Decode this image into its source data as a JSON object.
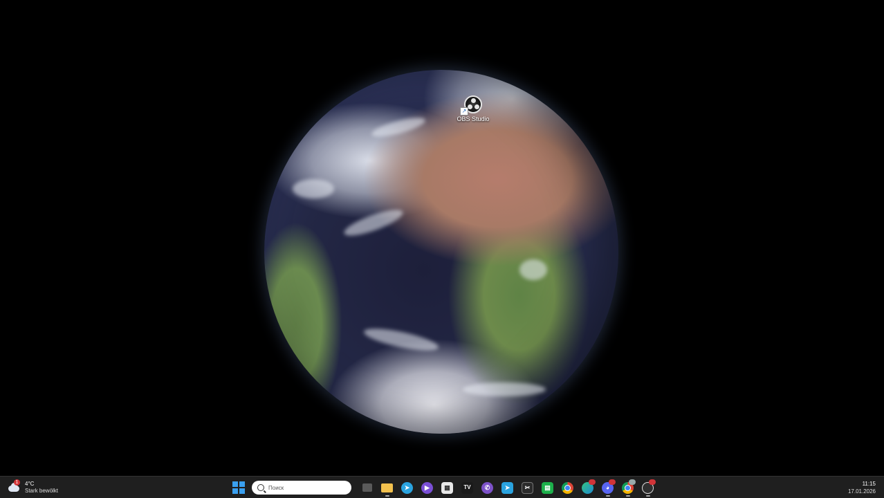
{
  "desktop": {
    "wallpaper": "earth-full-disk",
    "shortcuts": [
      {
        "label": "OBS Studio",
        "icon": "obs-studio-icon"
      }
    ]
  },
  "taskbar": {
    "weather": {
      "temperature": "4°C",
      "description": "Stark bewölkt",
      "badge": "1",
      "icon": "cloud-icon"
    },
    "search": {
      "placeholder": "Поиск"
    },
    "apps": [
      {
        "name": "task-view-icon",
        "color": "#5a5a5a"
      },
      {
        "name": "file-explorer-icon",
        "color": "#f2c14e"
      },
      {
        "name": "telegram-icon",
        "color": "#2aa3df"
      },
      {
        "name": "media-player-icon",
        "color": "#7a4fd6"
      },
      {
        "name": "calendar-app-icon",
        "color": "#e8e8e8"
      },
      {
        "name": "tradingview-icon",
        "color": "#1a1a1a"
      },
      {
        "name": "viber-icon",
        "color": "#7d52c9"
      },
      {
        "name": "telegram-desktop-icon",
        "color": "#2aa3df"
      },
      {
        "name": "capcut-icon",
        "color": "#2b2b2b"
      },
      {
        "name": "sheets-app-icon",
        "color": "#1db04b"
      },
      {
        "name": "chrome-icon",
        "color": "#e8e8e8"
      },
      {
        "name": "edge-icon",
        "color": "#1f8ad2"
      },
      {
        "name": "discord-icon",
        "color": "#5865f2"
      },
      {
        "name": "chrome-profile-icon",
        "color": "#e8e8e8"
      },
      {
        "name": "obs-studio-taskbar-icon",
        "color": "#2f2f2f"
      }
    ],
    "clock": {
      "time": "11:15",
      "date": "17.01.2026"
    }
  }
}
